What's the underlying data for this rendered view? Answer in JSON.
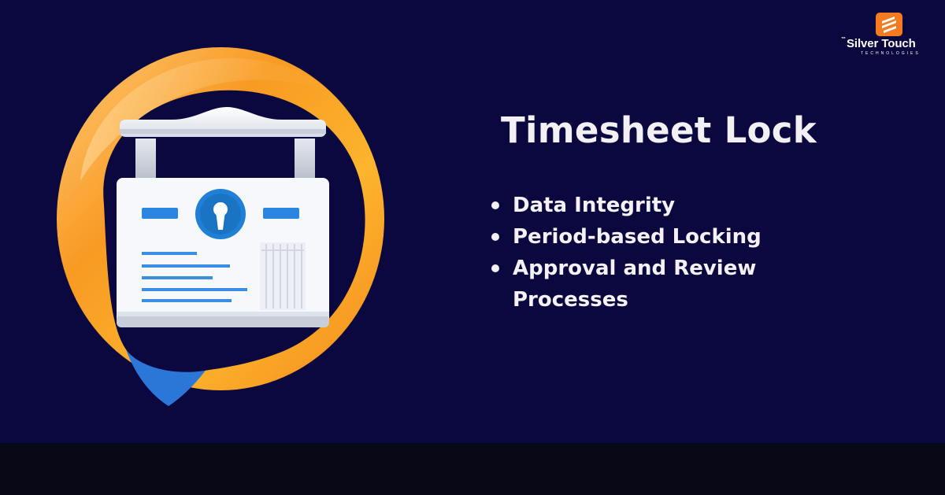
{
  "brand": {
    "tm": "™",
    "name": "Silver Touch",
    "tagline": "TECHNOLOGIES",
    "accent": "#f47b20"
  },
  "title": "Timesheet Lock",
  "features": [
    {
      "label": "Data Integrity"
    },
    {
      "label": "Period-based Locking"
    },
    {
      "label": "Approval and Review Processes"
    }
  ],
  "illustration": {
    "icon": "locked-timesheet-icon",
    "colors": {
      "ring": "#f8a11e",
      "card": "#f6f8fc",
      "keyhole": "#1f80d6",
      "background": "#0a083f"
    }
  },
  "colors": {
    "background": "#0a083f",
    "footer": "#090817",
    "text": "#f4f0f4"
  }
}
